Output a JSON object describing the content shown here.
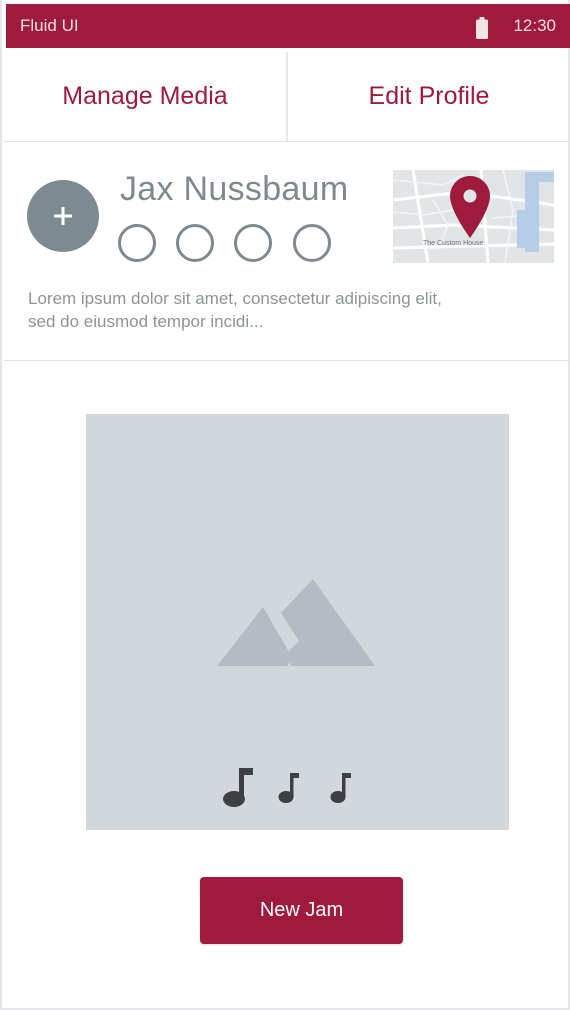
{
  "status_bar": {
    "title": "Fluid UI",
    "time": "12:30",
    "battery_icon": "battery-icon"
  },
  "tabs": [
    {
      "label": "Manage Media"
    },
    {
      "label": "Edit Profile"
    }
  ],
  "profile": {
    "name": "Jax Nussbaum",
    "add_icon": "plus-icon",
    "rating_dots": 4,
    "bio": "Lorem ipsum dolor sit amet, consectetur adipiscing elit, sed do eiusmod tempor incidi...",
    "map": {
      "caption": "The Custom House",
      "pin_icon": "map-pin-icon"
    }
  },
  "media": {
    "placeholder_icon": "mountain-image-icon",
    "note_icons": [
      "music-note-icon",
      "music-note-icon",
      "music-note-icon"
    ]
  },
  "actions": {
    "new_jam_label": "New Jam"
  },
  "colors": {
    "brand": "#9e1b3d",
    "gray_text": "#7d8a92",
    "placeholder_bg": "#d2d7dc",
    "placeholder_icon": "#b3bcc2"
  }
}
